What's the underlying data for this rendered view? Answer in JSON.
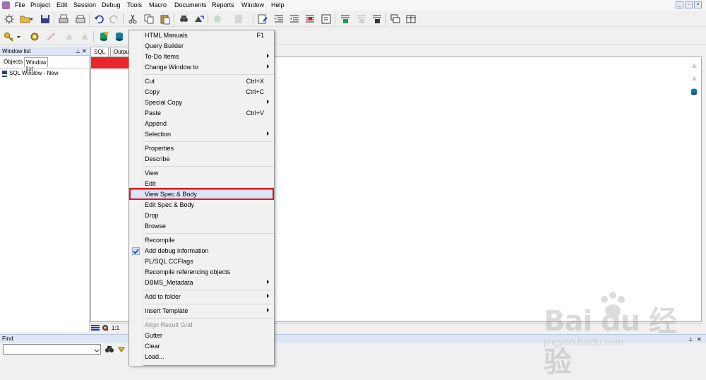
{
  "menubar": {
    "items": [
      "File",
      "Project",
      "Edit",
      "Session",
      "Debug",
      "Tools",
      "Macro",
      "Documents",
      "Reports",
      "Window",
      "Help"
    ],
    "window_controls": [
      "_",
      "▫",
      "×"
    ]
  },
  "left_panel": {
    "title": "Window list",
    "tabs": [
      "Objects",
      "Window list"
    ],
    "items": [
      "SQL Window - New"
    ]
  },
  "editor": {
    "tabs": [
      "SQL",
      "Output"
    ],
    "status_value": "1:1"
  },
  "find": {
    "title": "Find",
    "input_value": ""
  },
  "context_menu": {
    "items": [
      {
        "label": "HTML Manuals",
        "shortcut": "F1"
      },
      {
        "label": "Query Builder"
      },
      {
        "label": "To-Do Items",
        "submenu": true
      },
      {
        "label": "Change Window to",
        "submenu": true
      },
      {
        "label": "Cut",
        "shortcut": "Ctrl+X"
      },
      {
        "label": "Copy",
        "shortcut": "Ctrl+C"
      },
      {
        "label": "Special Copy",
        "submenu": true
      },
      {
        "label": "Paste",
        "shortcut": "Ctrl+V"
      },
      {
        "label": "Append"
      },
      {
        "label": "Selection",
        "submenu": true
      },
      {
        "label": "Properties"
      },
      {
        "label": "Describe"
      },
      {
        "label": "View"
      },
      {
        "label": "Edit"
      },
      {
        "label": "View Spec & Body",
        "highlighted": true
      },
      {
        "label": "Edit Spec & Body"
      },
      {
        "label": "Drop"
      },
      {
        "label": "Browse"
      },
      {
        "label": "Recompile"
      },
      {
        "label": "Add debug information",
        "checked": true
      },
      {
        "label": "PL/SQL CCFlags"
      },
      {
        "label": "Recompile referencing objects"
      },
      {
        "label": "DBMS_Metadata",
        "submenu": true
      },
      {
        "label": "Add to folder",
        "submenu": true
      },
      {
        "label": "Insert Template",
        "submenu": true
      },
      {
        "label": "Align Result Grid",
        "disabled": true
      },
      {
        "label": "Gutter"
      },
      {
        "label": "Clear"
      },
      {
        "label": "Load..."
      }
    ]
  },
  "watermark": {
    "main": "Bai du 经验",
    "sub": "jingyan.baidu.com"
  },
  "colors": {
    "highlight_border": "#e0161e",
    "red_bar": "#e8262a",
    "panel_title": "#dce6f4"
  }
}
